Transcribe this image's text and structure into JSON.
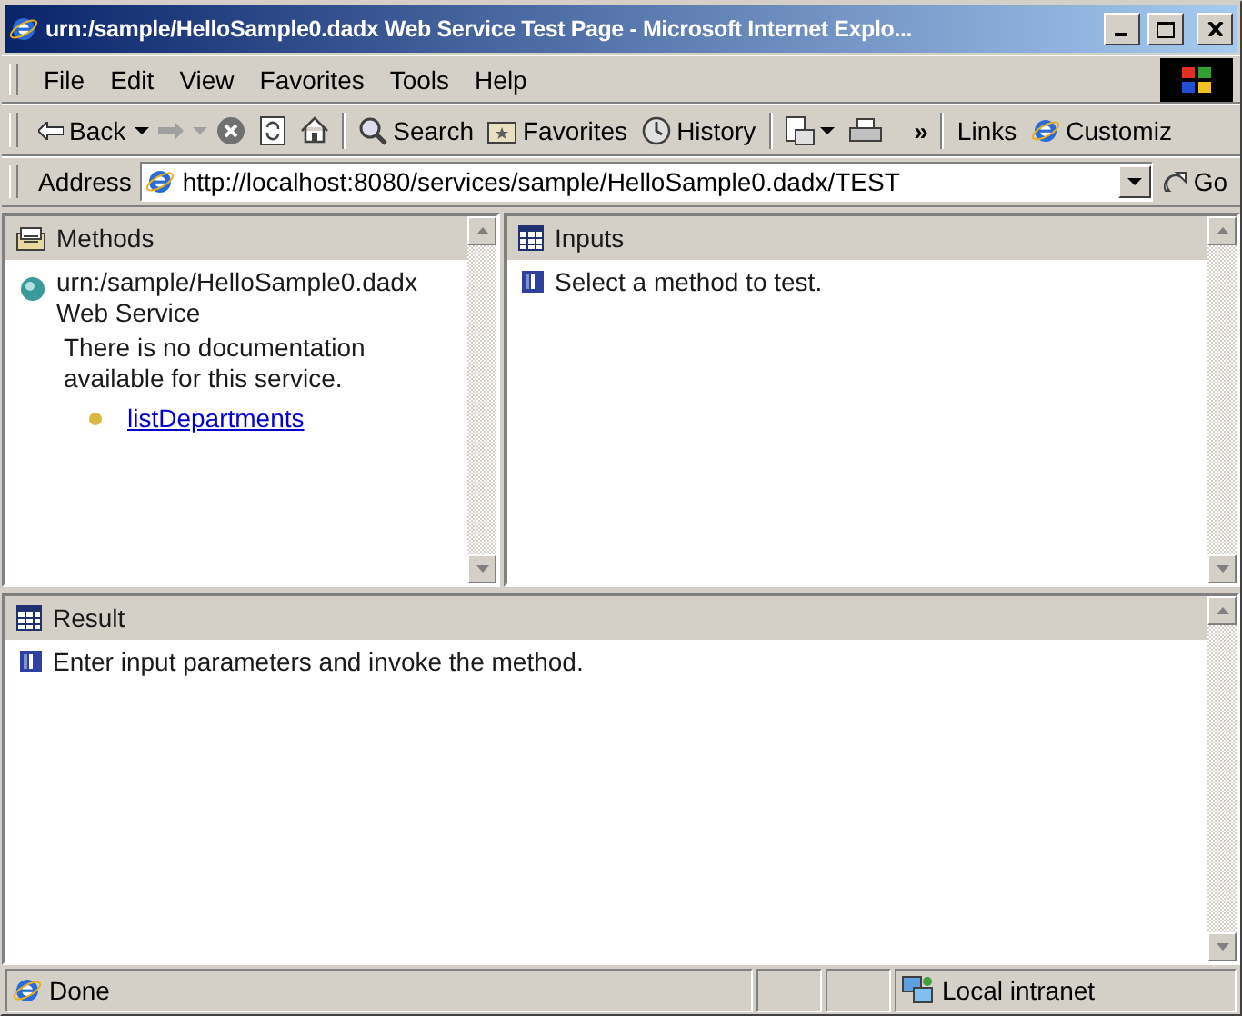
{
  "window": {
    "title": "urn:/sample/HelloSample0.dadx Web Service Test Page - Microsoft Internet Explo..."
  },
  "menu": [
    {
      "label": "File"
    },
    {
      "label": "Edit"
    },
    {
      "label": "View"
    },
    {
      "label": "Favorites"
    },
    {
      "label": "Tools"
    },
    {
      "label": "Help"
    }
  ],
  "toolbar": {
    "back": "Back",
    "forward_disabled": true,
    "search": "Search",
    "favorites": "Favorites",
    "history": "History",
    "more": "»",
    "links": "Links",
    "customize": "Customiz"
  },
  "address": {
    "label": "Address",
    "value": "http://localhost:8080/services/sample/HelloSample0.dadx/TEST",
    "go": "Go"
  },
  "methods": {
    "title": "Methods",
    "service": "urn:/sample/HelloSample0.dadx",
    "service_type": "Web Service",
    "documentation": "There is no documentation available for this service.",
    "items": [
      {
        "name": "listDepartments"
      }
    ]
  },
  "inputs": {
    "title": "Inputs",
    "message": "Select a method to test."
  },
  "result": {
    "title": "Result",
    "message": "Enter input parameters and invoke the method."
  },
  "status_bar": {
    "text": "Done",
    "zone": "Local intranet"
  }
}
